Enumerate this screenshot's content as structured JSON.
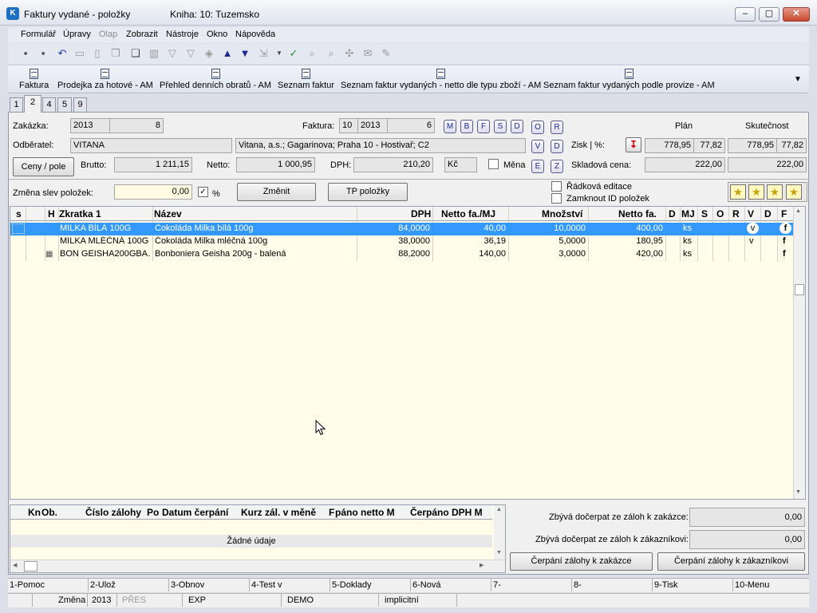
{
  "window": {
    "title": "Faktury vydané - položky",
    "book": "Kniha: 10: Tuzemsko",
    "minimize": "–",
    "maximize": "▢",
    "close": "✕"
  },
  "menu": [
    "Formulář",
    "Úpravy",
    "Olap",
    "Zobrazit",
    "Nástroje",
    "Okno",
    "Nápověda"
  ],
  "shortcuts": [
    "Faktura",
    "Prodejka za hotové - AM",
    "Přehled denních obratů - AM",
    "Seznam faktur",
    "Seznam faktur vydaných - netto dle typu zboží - AM",
    "Seznam faktur vydaných podle provize - AM"
  ],
  "tabs": [
    "1",
    "2",
    "4",
    "5",
    "9"
  ],
  "header": {
    "zakazka_label": "Zakázka:",
    "zakazka_year": "2013",
    "zakazka_num": "8",
    "odberatel_label": "Odběratel:",
    "odberatel_code": "VITANA",
    "odberatel_address": "Vitana, a.s.; Gagarinova; Praha 10 - Hostivař; C2",
    "ceny_button": "Ceny / pole",
    "brutto_label": "Brutto:",
    "brutto_value": "1 211,15",
    "netto_label": "Netto:",
    "netto_value": "1 000,95",
    "dph_label": "DPH:",
    "dph_value": "210,20",
    "currency": "Kč",
    "mena_label": "Měna",
    "faktura_label": "Faktura:",
    "faktura_book": "10",
    "faktura_year": "2013",
    "faktura_num": "6",
    "mbfsd": [
      "M",
      "B",
      "F",
      "S",
      "D"
    ],
    "side_letters": [
      "O",
      "R",
      "V",
      "D",
      "E",
      "Z"
    ],
    "plan_label": "Plán",
    "skutecnost_label": "Skutečnost",
    "zisk_label": "Zisk | %:",
    "zisk_plan": "778,95",
    "zisk_plan_pct": "77,82",
    "zisk_skut": "778,95",
    "zisk_skut_pct": "77,82",
    "skladova_label": "Skladová cena:",
    "skladova_plan": "222,00",
    "skladova_skut": "222,00",
    "zmena_slev_label": "Změna slev položek:",
    "zmena_slev_value": "0,00",
    "percent": "%",
    "zmenit_button": "Změnit",
    "tp_button": "TP položky",
    "radkova_label": "Řádková editace",
    "zamknout_label": "Zamknout ID položek"
  },
  "grid": {
    "columns": [
      "s",
      "H",
      "Zkratka 1",
      "Název",
      "DPH",
      "Netto fa./MJ",
      "Množství",
      "Netto fa.",
      "D",
      "MJ",
      "S",
      "O",
      "R",
      "V",
      "D",
      "F"
    ],
    "rows": [
      {
        "zkratka": "MILKA BÍLÁ 100G",
        "nazev": "Čokoláda Milka bílá 100g",
        "dph": "84,0000",
        "netto_mj": "40,00",
        "mnozstvi": "10,0000",
        "netto": "400,00",
        "mj": "ks",
        "v": "v",
        "f": "f"
      },
      {
        "zkratka": "MILKA MLÉČNÁ 100G",
        "nazev": "Čokoláda Milka mléčná 100g",
        "dph": "38,0000",
        "netto_mj": "36,19",
        "mnozstvi": "5,0000",
        "netto": "180,95",
        "mj": "ks",
        "v": "v",
        "f": "f"
      },
      {
        "zkratka": "BON GEISHA200GBA…",
        "nazev": "Bonboniera Geisha 200g - balená",
        "dph": "88,2000",
        "netto_mj": "140,00",
        "mnozstvi": "3,0000",
        "netto": "420,00",
        "mj": "ks",
        "v": "",
        "f": "f"
      }
    ]
  },
  "subgrid": {
    "columns": [
      "Kn",
      "Ob.",
      "Číslo zálohy",
      "Po",
      "Datum čerpání",
      "Kurz zál. v měně",
      "F",
      "páno netto M",
      "Čerpáno DPH M"
    ],
    "empty": "Žádné údaje"
  },
  "zalohy": {
    "zakazka_label": "Zbývá dočerpat ze záloh k zakázce:",
    "zakazka_value": "0,00",
    "zakaznik_label": "Zbývá dočerpat ze záloh k zákazníkovi:",
    "zakaznik_value": "0,00",
    "btn_zakazka": "Čerpání zálohy k zakázce",
    "btn_zakaznik": "Čerpání zálohy k zákazníkovi"
  },
  "fkeys": [
    "1-Pomoc",
    "2-Ulož",
    "3-Obnov",
    "4-Test v",
    "5-Doklady",
    "6-Nová",
    "7-",
    "8-",
    "9-Tisk",
    "10-Menu"
  ],
  "status": [
    "Změna",
    "2013",
    "PŘES",
    "EXP",
    "DEMO",
    "implicitní"
  ]
}
